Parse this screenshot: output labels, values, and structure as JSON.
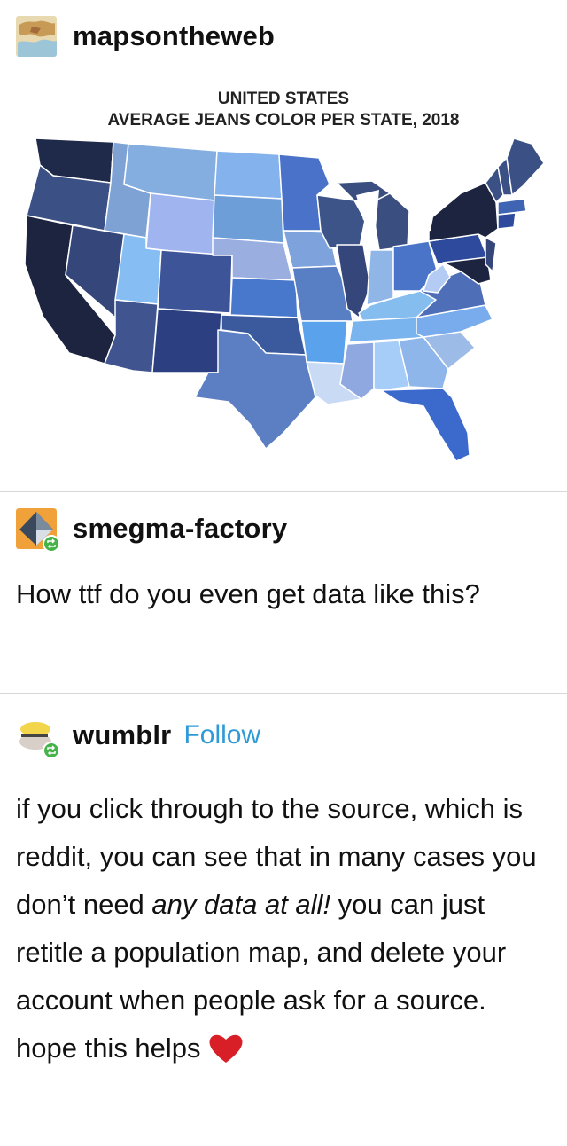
{
  "post1": {
    "username": "mapsontheweb",
    "map_title_line1": "UNITED STATES",
    "map_title_line2": "AVERAGE JEANS COLOR PER STATE, 2018"
  },
  "post2": {
    "username": "smegma-factory",
    "text": "How ttf do you even get data like this?"
  },
  "post3": {
    "username": "wumblr",
    "follow_label": "Follow",
    "text_before_italic": "if you click through to the source, which is reddit, you can see that in many cases you don’t need ",
    "text_italic": "any data at all!",
    "text_after_italic": " you can just retitle a population map, and delete your account when people ask for a source. hope this helps"
  },
  "icons": {
    "avatar1": "world-map-avatar-icon",
    "avatar2": "paper-plane-avatar-icon",
    "avatar3": "cat-avatar-icon",
    "reblog": "reblog-icon",
    "heart": "heart-icon"
  },
  "colors": {
    "follow": "#2e9ad8",
    "reblog_badge": "#45b24a",
    "heart": "#d81e26"
  }
}
